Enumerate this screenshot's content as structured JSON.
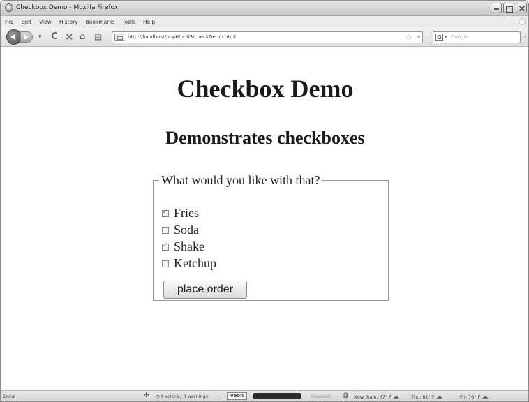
{
  "window": {
    "title": "Checkbox Demo - Mozilla Firefox"
  },
  "menu": [
    "File",
    "Edit",
    "View",
    "History",
    "Bookmarks",
    "Tools",
    "Help"
  ],
  "navbar": {
    "url": "http://localhost/php6/ph03/checkDemo.html",
    "search_placeholder": "Google",
    "search_engine_letter": "G"
  },
  "page": {
    "heading": "Checkbox Demo",
    "subheading": "Demonstrates checkboxes",
    "legend": "What would you like with that?",
    "options": [
      {
        "label": "Fries",
        "checked": true
      },
      {
        "label": "Soda",
        "checked": false
      },
      {
        "label": "Shake",
        "checked": true
      },
      {
        "label": "Ketchup",
        "checked": false
      }
    ],
    "submit_label": "place order"
  },
  "status": {
    "done": "Done",
    "errors": "0 errors / 0 warnings",
    "veoh": "veoh",
    "disabled": "Disabled",
    "now": "Now: Rain, 67° F",
    "thu": "Thu: 81° F",
    "fri": "Fri: 76° F"
  }
}
